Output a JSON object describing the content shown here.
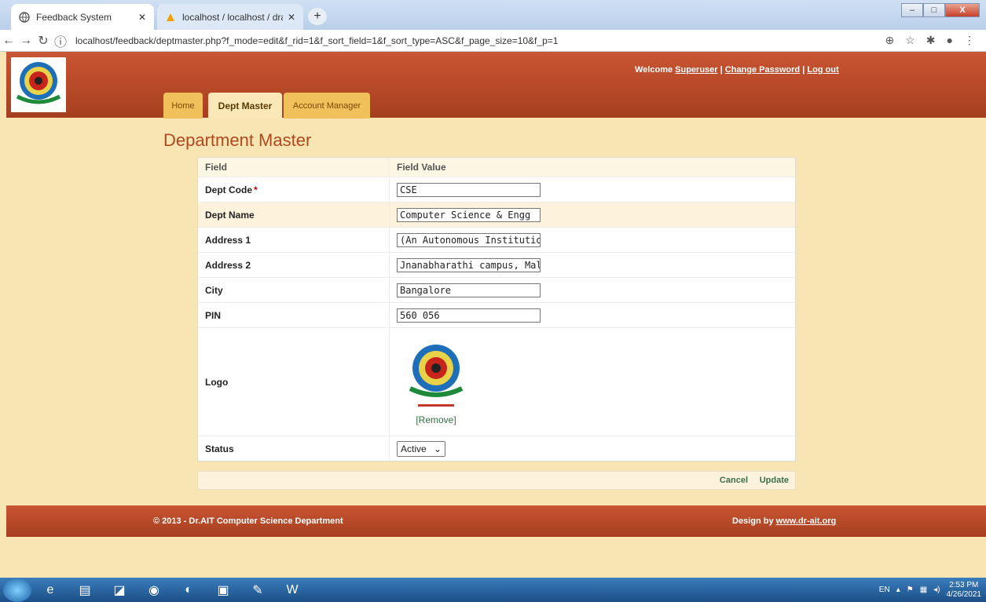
{
  "browser": {
    "tabs": [
      {
        "title": "Feedback System"
      },
      {
        "title": "localhost / localhost / drait / dra"
      }
    ],
    "url": "localhost/feedback/deptmaster.php?f_mode=edit&f_rid=1&f_sort_field=1&f_sort_type=ASC&f_page_size=10&f_p=1"
  },
  "header": {
    "welcome_prefix": "Welcome",
    "user": "Superuser",
    "change_password": "Change Password",
    "logout": "Log out",
    "separator": "|"
  },
  "menu": {
    "home": "Home",
    "dept": "Dept Master",
    "account": "Account Manager"
  },
  "page": {
    "title": "Department Master"
  },
  "form": {
    "col_field": "Field",
    "col_value": "Field Value",
    "dept_code_label": "Dept Code",
    "required_mark": "*",
    "dept_code": "CSE",
    "dept_name_label": "Dept Name",
    "dept_name": "Computer Science & Engg",
    "address1_label": "Address 1",
    "address1": "(An Autonomous Institution, Aid",
    "address2_label": "Address 2",
    "address2": "Jnanabharathi campus, Mallatha",
    "city_label": "City",
    "city": "Bangalore",
    "pin_label": "PIN",
    "pin": "560 056",
    "logo_label": "Logo",
    "remove": "[Remove]",
    "status_label": "Status",
    "status": "Active",
    "cancel": "Cancel",
    "update": "Update"
  },
  "footer": {
    "copyright": "© 2013 - Dr.AIT Computer Science Department",
    "design_prefix": "Design by",
    "design_link": "www.dr-ait.org"
  },
  "taskbar": {
    "lang": "EN",
    "time": "2:53 PM",
    "date": "4/26/2021"
  },
  "colors": {
    "header": "#b7472a",
    "background": "#f7e6b3",
    "accent": "#b3471d",
    "action": "#3c6e47"
  }
}
